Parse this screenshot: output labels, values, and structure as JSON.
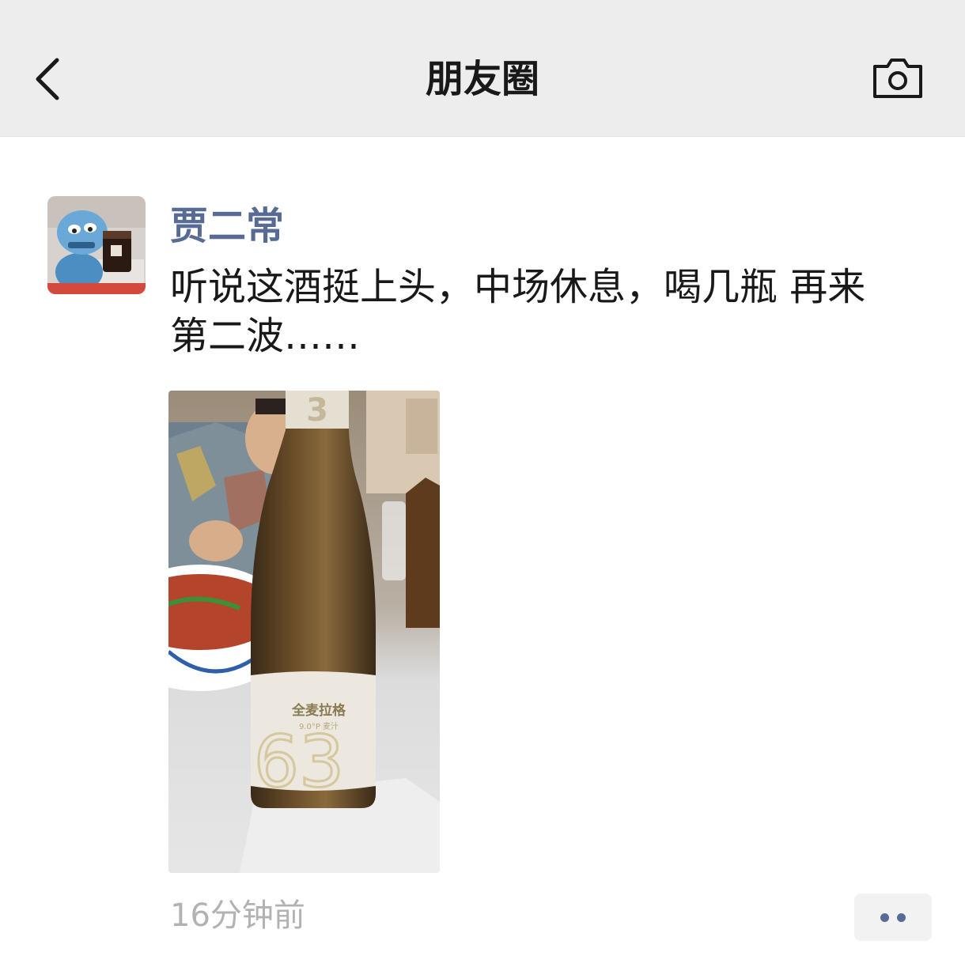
{
  "nav": {
    "title": "朋友圈",
    "back_icon": "chevron-left-icon",
    "camera_icon": "camera-icon"
  },
  "post": {
    "username": "贾二常",
    "text": "听说这酒挺上头，中场休息，喝几瓶 再来\n第二波……",
    "timestamp": "16分钟前",
    "photo": {
      "label_line1": "全麦拉格",
      "label_line2": "9.0°P 麦汁",
      "label_number": "3"
    },
    "more_icon": "more-dots-icon"
  },
  "colors": {
    "nav_bg": "#ededed",
    "username": "#576b95",
    "timestamp": "#b2b2b2",
    "text": "#191919"
  }
}
